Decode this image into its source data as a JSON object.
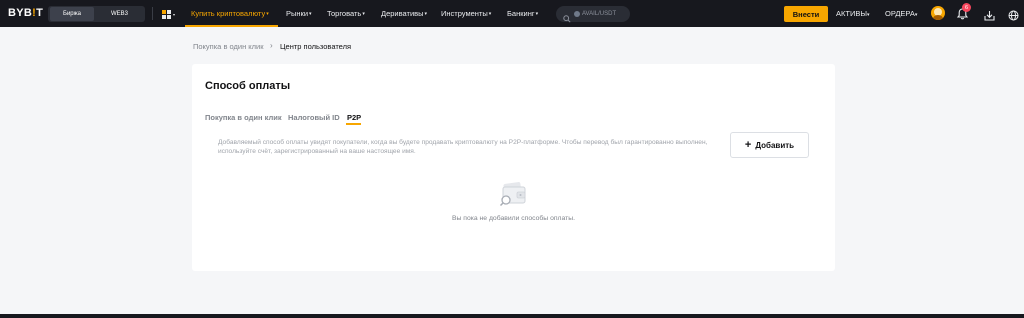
{
  "header": {
    "logo": {
      "text_main": "BYB",
      "text_accent": "!",
      "text_end": "T"
    },
    "mode_switch": {
      "active": "Биржа",
      "other": "WEB3"
    },
    "nav": [
      {
        "label": "Купить криптовалюту",
        "caret": "▾"
      },
      {
        "label": "Рынки",
        "caret": "▾"
      },
      {
        "label": "Торговать",
        "caret": "▾"
      },
      {
        "label": "Деривативы",
        "caret": "▾"
      },
      {
        "label": "Инструменты",
        "caret": "▾"
      },
      {
        "label": "Банкинг",
        "caret": "▾"
      }
    ],
    "search": {
      "placeholder": "AVAIL/USDT"
    },
    "deposit_label": "Внести",
    "assets": {
      "label": "АКТИВЫ",
      "caret": "▾"
    },
    "orders": {
      "label": "ОРДЕРА",
      "caret": "▾"
    },
    "notification_count": "6",
    "accent_color": "#f7a600"
  },
  "breadcrumb": {
    "link": "Покупка в один клик",
    "separator": "›",
    "current": "Центр пользователя"
  },
  "card": {
    "title": "Способ оплаты",
    "tabs": [
      {
        "label": "Покупка в один клик",
        "active": false
      },
      {
        "label": "Налоговый ID",
        "active": false
      },
      {
        "label": "P2P",
        "active": true
      }
    ],
    "description": "Добавляемый способ оплаты увидят покупатели, когда вы будете продавать криптовалюту на P2P-платформе. Чтобы перевод был гарантированно выполнен, используйте счёт, зарегистрированный на ваше настоящее имя.",
    "add_button": {
      "icon": "+",
      "label": "Добавить"
    },
    "empty_state": "Вы пока не добавили способы оплаты."
  },
  "icons": [
    "apps-grid-icon",
    "caret-down-icon",
    "search-icon",
    "avatar",
    "bell-icon",
    "download-icon",
    "globe-icon",
    "plus-icon",
    "empty-wallet-icon"
  ]
}
